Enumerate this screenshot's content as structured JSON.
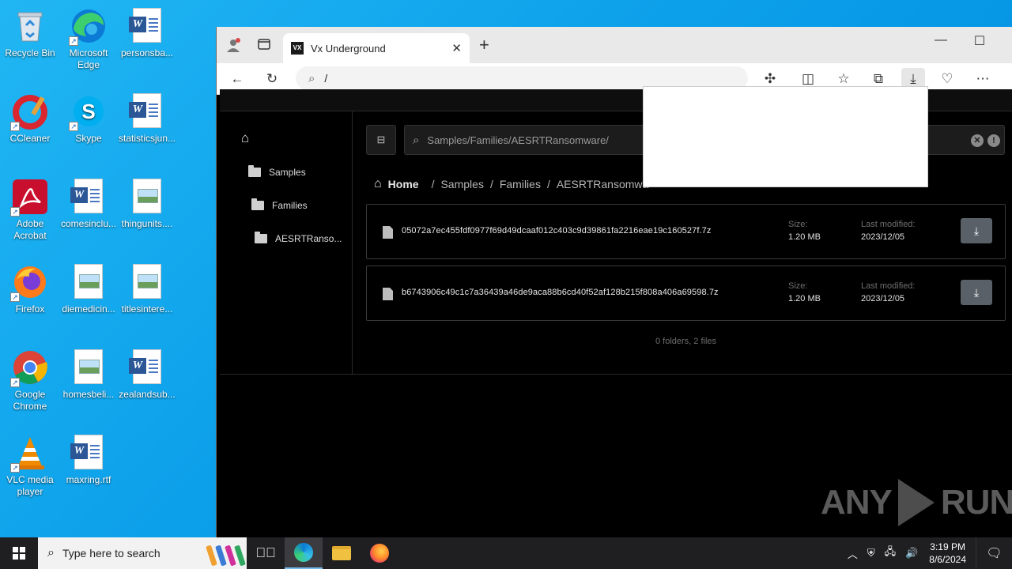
{
  "desktop": {
    "icons": [
      {
        "label": "Recycle Bin",
        "icon": "recycle-bin-icon"
      },
      {
        "label": "Microsoft Edge",
        "icon": "edge-icon"
      },
      {
        "label": "personsba...",
        "icon": "word-doc-icon"
      },
      {
        "label": "CCleaner",
        "icon": "ccleaner-icon"
      },
      {
        "label": "Skype",
        "icon": "skype-icon"
      },
      {
        "label": "statisticsjun...",
        "icon": "word-doc-icon"
      },
      {
        "label": "Adobe Acrobat",
        "icon": "acrobat-icon"
      },
      {
        "label": "comesinclu...",
        "icon": "word-doc-icon"
      },
      {
        "label": "thingunits....",
        "icon": "image-file-icon"
      },
      {
        "label": "Firefox",
        "icon": "firefox-icon"
      },
      {
        "label": "diemedicin...",
        "icon": "image-file-icon"
      },
      {
        "label": "titlesintere...",
        "icon": "image-file-icon"
      },
      {
        "label": "Google Chrome",
        "icon": "chrome-icon"
      },
      {
        "label": "homesbeli...",
        "icon": "image-file-icon"
      },
      {
        "label": "zealandsub...",
        "icon": "word-doc-icon"
      },
      {
        "label": "VLC media player",
        "icon": "vlc-icon"
      },
      {
        "label": "maxring.rtf",
        "icon": "word-doc-icon"
      }
    ]
  },
  "browser": {
    "tab_title": "Vx Underground",
    "tab_favicon": "VX",
    "address": "/",
    "page": {
      "sidebar": [
        {
          "label": "Samples"
        },
        {
          "label": "Families"
        },
        {
          "label": "AESRTRanso..."
        }
      ],
      "search_value": "Samples/Families/AESRTRansomware/",
      "breadcrumb": {
        "home": "Home",
        "parts": [
          "Samples",
          "Families",
          "AESRTRansomwa"
        ]
      },
      "size_label": "Size:",
      "modified_label": "Last modified:",
      "files": [
        {
          "name": "05072a7ec455fdf0977f69d49dcaaf012c403c9d39861fa2216eae19c160527f.7z",
          "size": "1.20 MB",
          "modified": "2023/12/05"
        },
        {
          "name": "b6743906c49c1c7a36439a46de9aca88b6cd40f52af128b215f808a406a69598.7z",
          "size": "1.20 MB",
          "modified": "2023/12/05"
        }
      ],
      "summary": "0 folders, 2 files"
    }
  },
  "watermark": {
    "left": "ANY",
    "right": "RUN"
  },
  "taskbar": {
    "search_placeholder": "Type here to search",
    "time": "3:19 PM",
    "date": "8/6/2024"
  }
}
